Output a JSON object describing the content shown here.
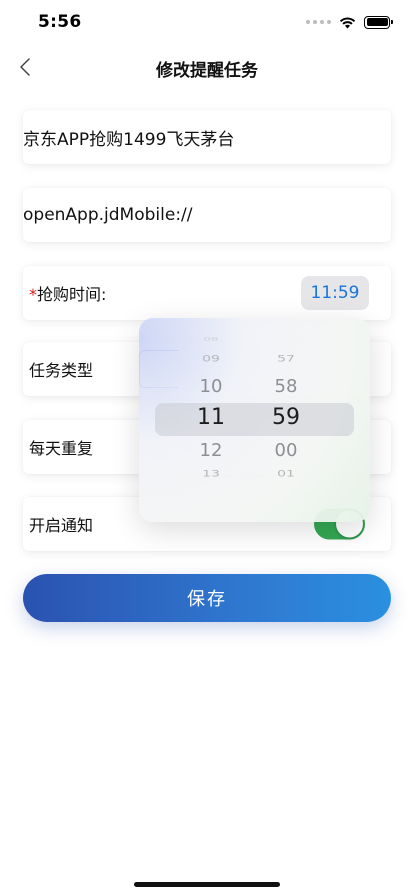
{
  "status_bar": {
    "time": "5:56"
  },
  "nav": {
    "title": "修改提醒任务"
  },
  "form": {
    "name_value": "京东APP抢购1499飞天茅台",
    "url_value": "openApp.jdMobile://",
    "time_row": {
      "required_mark": "*",
      "label": "抢购时间:",
      "value": "11:59"
    },
    "type_row": {
      "label": "任务类型"
    },
    "repeat_row": {
      "label": "每天重复"
    },
    "notify_row": {
      "label": "开启通知",
      "enabled": true
    },
    "save_label": "保存"
  },
  "time_picker": {
    "hours": [
      "09",
      "10",
      "11",
      "12",
      "13"
    ],
    "minutes": [
      "57",
      "58",
      "59",
      "00",
      "01"
    ],
    "selected_hour": "11",
    "selected_minute": "59"
  },
  "colors": {
    "accent_blue": "#2f78d0",
    "time_text": "#1a73d9",
    "toggle_on": "#34a853",
    "required": "#e02020"
  }
}
